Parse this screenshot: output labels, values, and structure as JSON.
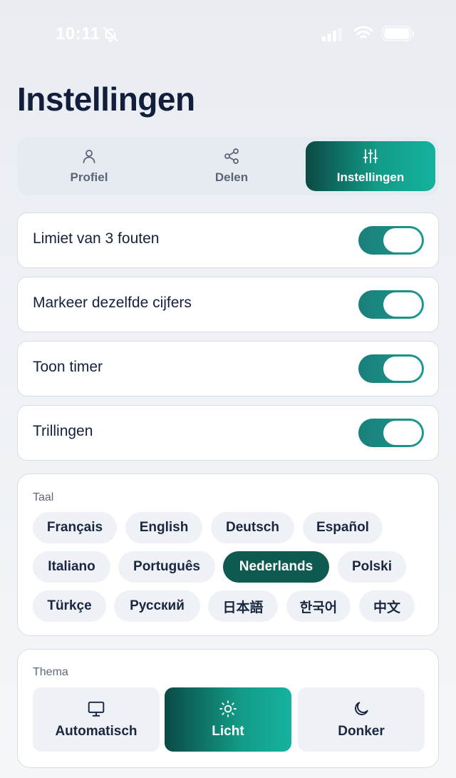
{
  "status_bar": {
    "time": "10:11",
    "icons": [
      "bell-slash-icon",
      "signal-icon",
      "wifi-icon",
      "battery-icon"
    ]
  },
  "page_title": "Instellingen",
  "tabs": [
    {
      "label": "Profiel",
      "icon": "user-icon",
      "active": false
    },
    {
      "label": "Delen",
      "icon": "share-icon",
      "active": false
    },
    {
      "label": "Instellingen",
      "icon": "sliders-icon",
      "active": true
    }
  ],
  "toggles": [
    {
      "label": "Limiet van 3 fouten",
      "on": true
    },
    {
      "label": "Markeer dezelfde cijfers",
      "on": true
    },
    {
      "label": "Toon timer",
      "on": true
    },
    {
      "label": "Trillingen",
      "on": true
    }
  ],
  "language": {
    "title": "Taal",
    "options": [
      "Français",
      "English",
      "Deutsch",
      "Español",
      "Italiano",
      "Português",
      "Nederlands",
      "Polski",
      "Türkçe",
      "Русский",
      "日本語",
      "한국어",
      "中文"
    ],
    "selected": "Nederlands"
  },
  "theme": {
    "title": "Thema",
    "options": [
      {
        "label": "Automatisch",
        "icon": "monitor-icon",
        "selected": false
      },
      {
        "label": "Licht",
        "icon": "sun-icon",
        "selected": true
      },
      {
        "label": "Donker",
        "icon": "moon-icon",
        "selected": false
      }
    ]
  },
  "colors": {
    "accent": "#139b88",
    "accent_dark": "#0b4a45",
    "title": "#121e3b"
  }
}
